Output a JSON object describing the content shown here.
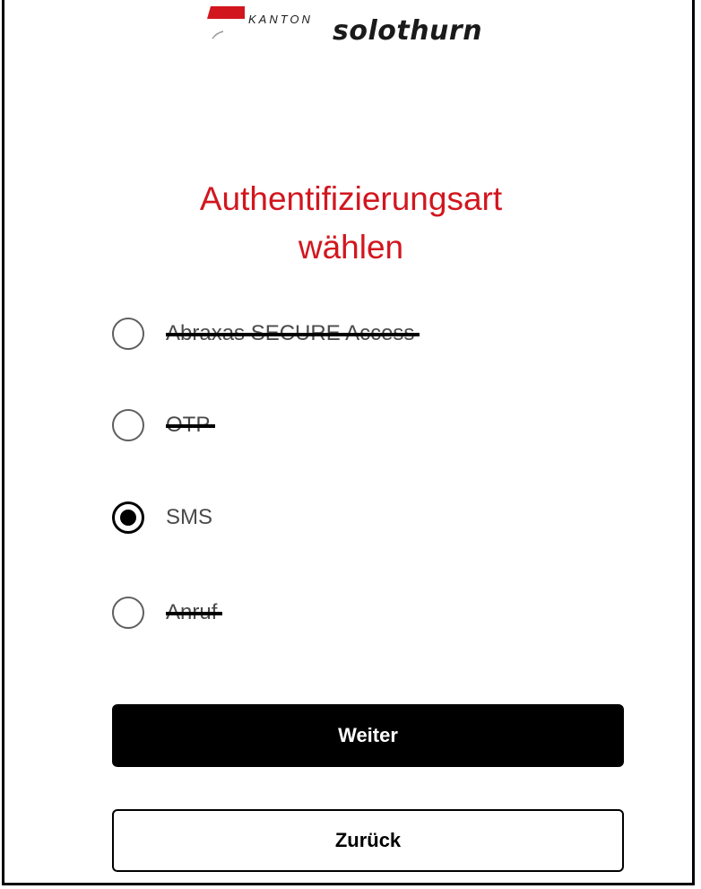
{
  "logo": {
    "kanton": "KANTON",
    "name": "solothurn",
    "brand_color": "#d2161e"
  },
  "title": {
    "line1": "Authentifizierungsart",
    "line2": "wählen"
  },
  "options": [
    {
      "label": "Abraxas SECURE Access",
      "checked": false,
      "struck_through": true
    },
    {
      "label": "OTP",
      "checked": false,
      "struck_through": true
    },
    {
      "label": "SMS",
      "checked": true,
      "struck_through": false
    },
    {
      "label": "Anruf",
      "checked": false,
      "struck_through": true
    }
  ],
  "buttons": {
    "next_label": "Weiter",
    "back_label": "Zurück"
  },
  "colors": {
    "title": "#d2161e",
    "primary_button_bg": "#000000",
    "primary_button_text": "#ffffff"
  }
}
